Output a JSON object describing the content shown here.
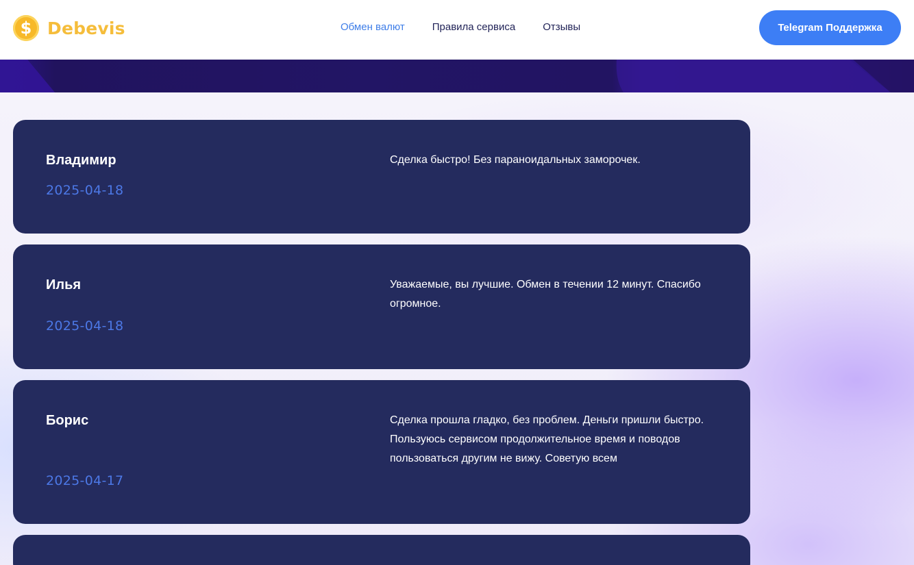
{
  "header": {
    "logo_symbol": "$",
    "logo_text": "Debevis",
    "nav": [
      {
        "label": "Обмен валют",
        "active": true
      },
      {
        "label": "Правила сервиса",
        "active": false
      },
      {
        "label": "Отзывы",
        "active": false
      }
    ],
    "support_button": "Telegram Поддержка"
  },
  "colors": {
    "accent": "#3d7ef5",
    "brand_gold": "#f5bd3b",
    "card_bg": "#242b5e",
    "date_color": "#4c78e6",
    "banner": "#221565"
  },
  "reviews": [
    {
      "name": "Владимир",
      "date": "2025-04-18",
      "text": "Сделка быстро! Без параноидальных заморочек."
    },
    {
      "name": "Илья",
      "date": "2025-04-18",
      "text": "Уважаемые, вы лучшие. Обмен в течении 12 минут. Спасибо огромное."
    },
    {
      "name": "Борис",
      "date": "2025-04-17",
      "text": "Сделка прошла гладко, без проблем. Деньги пришли быстро. Пользуюсь сервисом продолжительное время и поводов пользоваться другим не вижу. Советую всем"
    },
    {
      "name": "",
      "date": "",
      "text": ""
    }
  ]
}
